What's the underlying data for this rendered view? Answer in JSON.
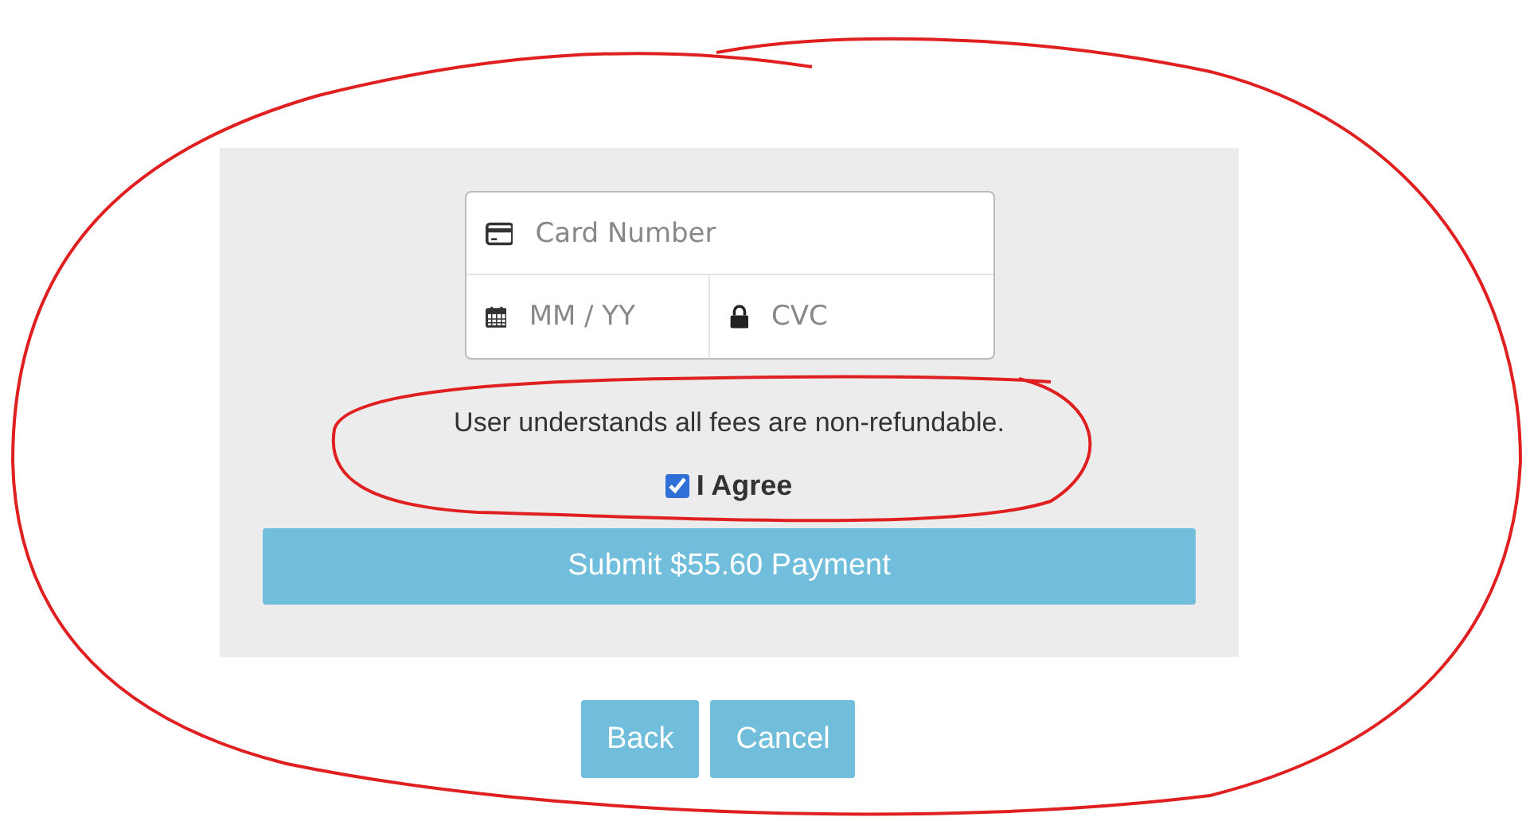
{
  "card_form": {
    "card_number": {
      "placeholder": "Card Number"
    },
    "expiry": {
      "placeholder": "MM / YY"
    },
    "cvc": {
      "placeholder": "CVC"
    }
  },
  "notice": "User understands all fees are non-refundable.",
  "agree": {
    "label": "I Agree",
    "checked": true
  },
  "submit_button": "Submit $55.60 Payment",
  "buttons": [
    "Back",
    "Cancel"
  ],
  "annotations": [
    {
      "color": "#e02020"
    },
    {
      "color": "#e02020"
    }
  ]
}
